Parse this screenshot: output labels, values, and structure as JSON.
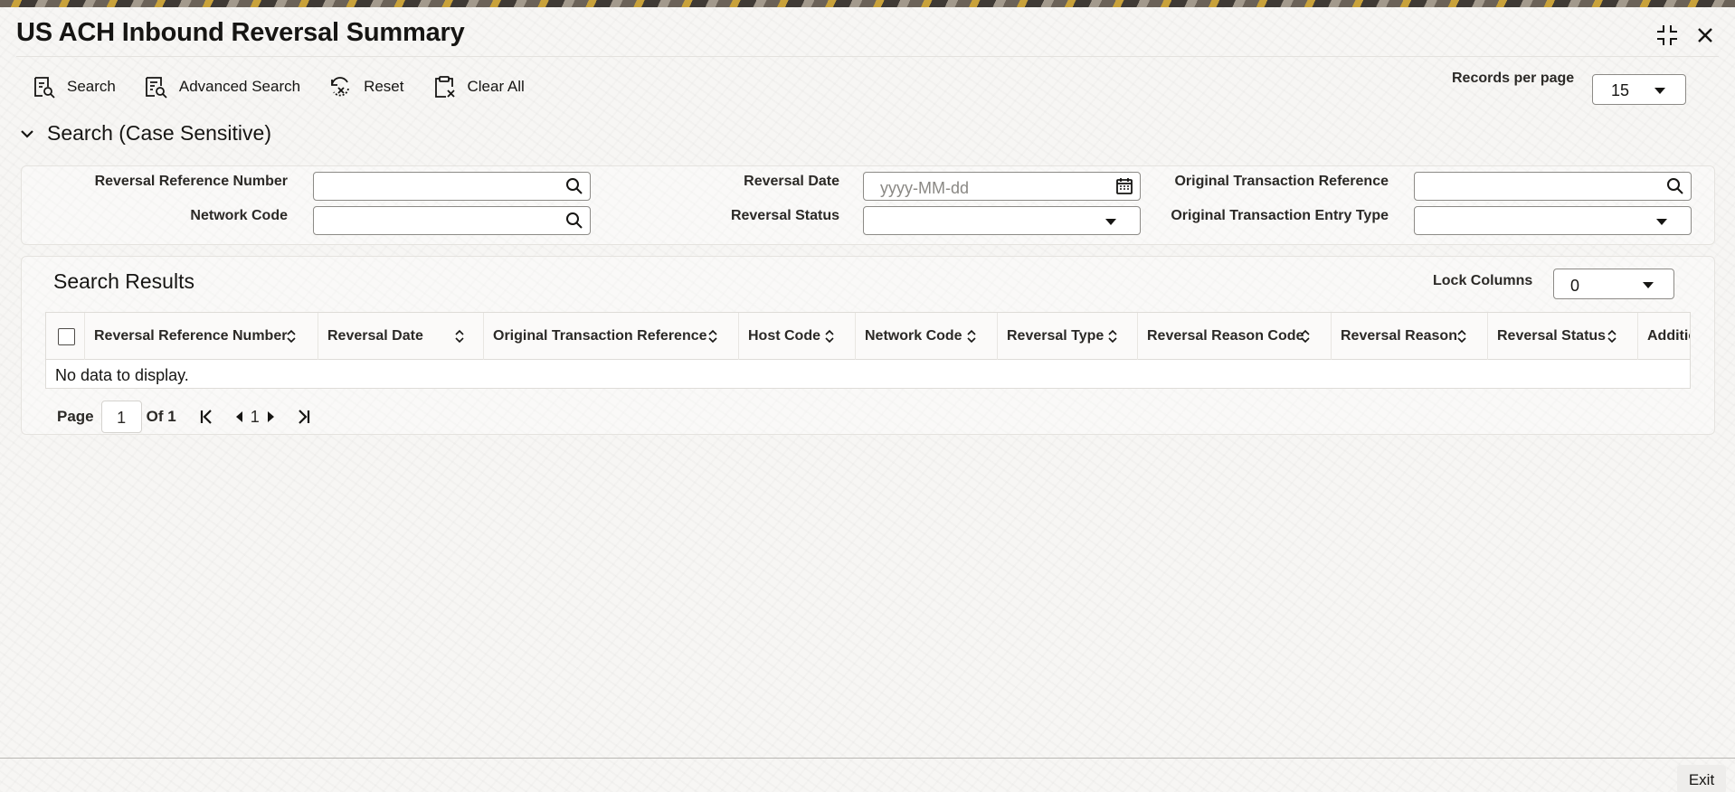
{
  "window": {
    "title": "US ACH Inbound Reversal Summary"
  },
  "toolbar": {
    "search_label": "Search",
    "advanced_search_label": "Advanced Search",
    "reset_label": "Reset",
    "clear_all_label": "Clear All",
    "records_per_page_label": "Records per page",
    "records_per_page_value": "15"
  },
  "search_section": {
    "title": "Search (Case Sensitive)",
    "fields": {
      "reversal_reference_number": {
        "label": "Reversal Reference Number",
        "value": ""
      },
      "network_code": {
        "label": "Network Code",
        "value": ""
      },
      "reversal_date": {
        "label": "Reversal Date",
        "value": "",
        "placeholder": "yyyy-MM-dd"
      },
      "reversal_status": {
        "label": "Reversal Status",
        "value": ""
      },
      "original_transaction_reference": {
        "label": "Original Transaction Reference",
        "value": ""
      },
      "original_transaction_entry_type": {
        "label": "Original Transaction Entry Type",
        "value": ""
      }
    }
  },
  "results": {
    "title": "Search Results",
    "lock_columns_label": "Lock Columns",
    "lock_columns_value": "0",
    "columns": [
      "Reversal Reference Number",
      "Reversal Date",
      "Original Transaction Reference",
      "Host Code",
      "Network Code",
      "Reversal Type",
      "Reversal Reason Code",
      "Reversal Reason",
      "Reversal Status",
      "Additic"
    ],
    "empty_message": "No data to display."
  },
  "pagination": {
    "page_label": "Page",
    "current_page": "1",
    "of_label": "Of 1",
    "page_number": "1"
  },
  "footer": {
    "exit_label": "Exit"
  },
  "icons": {
    "search": "search-icon",
    "calendar": "calendar-icon",
    "collapse": "collapse-icon",
    "close": "close-icon",
    "chevron_down": "chevron-down-icon",
    "sort": "sort-icon"
  }
}
